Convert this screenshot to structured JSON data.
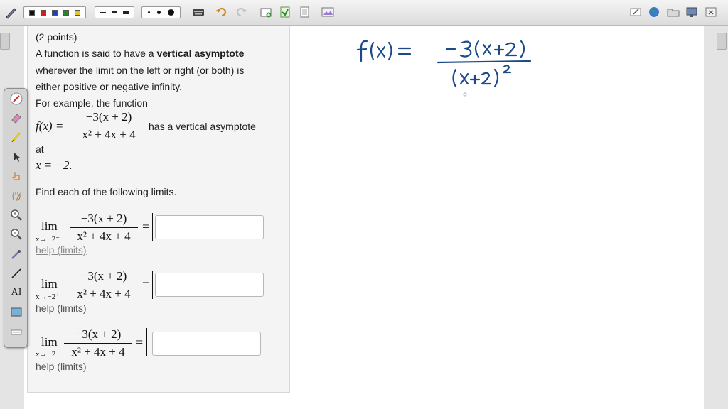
{
  "toolbar": {
    "colors": [
      "#111111",
      "#d21e1e",
      "#1e3fbf",
      "#1e8a2e",
      "#e6c619"
    ],
    "icons": [
      "pen-icon",
      "color-swatches",
      "line-styles",
      "point-sizes",
      "keyboard-icon",
      "undo-icon",
      "redo-icon",
      "new-page-icon",
      "insert-page-icon",
      "page-icon",
      "image-icon",
      "edit-icon",
      "globe-icon",
      "folder-icon",
      "screen-icon",
      "close-icon"
    ]
  },
  "palette": {
    "tools": [
      "pen-icon",
      "eraser-icon",
      "highlighter-icon",
      "pointer-icon",
      "hand-pointer-icon",
      "pan-hand-icon",
      "zoom-in-icon",
      "zoom-out-icon",
      "eyedropper-icon",
      "line-icon",
      "text-icon",
      "screen-capture-icon",
      "keyboard-icon"
    ],
    "text_tool_label": "AI"
  },
  "problem": {
    "points": "(2 points)",
    "intro_1": "A function is said to have a ",
    "intro_bold": "vertical asymptote",
    "intro_2": "wherever the limit on the left or right (or both) is",
    "intro_3": "either positive or negative infinity.",
    "example_lead": "For example, the function",
    "fx": "f(x) =",
    "numerator": "−3(x + 2)",
    "denominator": "x² + 4x + 4",
    "has_va": "has a vertical asymptote",
    "at": "at",
    "x_eq": "x = −2",
    "period": ".",
    "find": "Find each of the following limits.",
    "limits": [
      {
        "lim": "lim",
        "sub": "x→−2⁻",
        "num": "−3(x + 2)",
        "den": "x² + 4x + 4",
        "eq": "=",
        "help": "help (limits)"
      },
      {
        "lim": "lim",
        "sub": "x→−2⁺",
        "num": "−3(x + 2)",
        "den": "x² + 4x + 4",
        "eq": "=",
        "help": "help (limits)"
      },
      {
        "lim": "lim",
        "sub": "x→−2",
        "num": "−3(x + 2)",
        "den": "x² + 4x + 4",
        "eq": "=",
        "help": "help (limits)"
      }
    ]
  },
  "handwriting": {
    "lhs": "f(x) =",
    "numerator": "− 3(x+2)",
    "denominator": "(x+2)",
    "exponent": "2",
    "ink_color": "#1a4a8a"
  }
}
